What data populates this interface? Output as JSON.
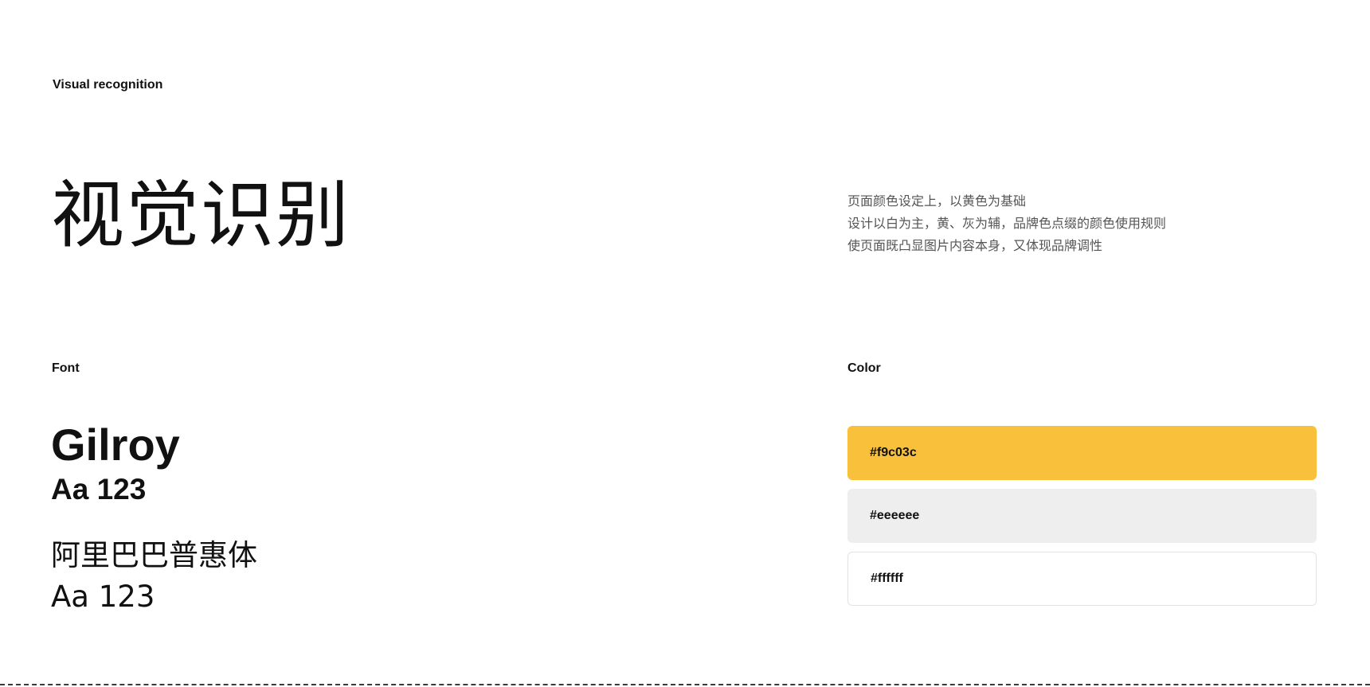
{
  "header": {
    "section_label": "Visual recognition",
    "title": "视觉识别"
  },
  "description": {
    "lines": [
      "页面颜色设定上，以黄色为基础",
      "设计以白为主，黄、灰为辅，品牌色点缀的颜色使用规则",
      "使页面既凸显图片内容本身，又体现品牌调性"
    ]
  },
  "font_section": {
    "label": "Font",
    "latin_font_name": "Gilroy",
    "latin_sample": "Aa 123",
    "cn_font_name": "阿里巴巴普惠体",
    "cn_sample": "Aa 123"
  },
  "color_section": {
    "label": "Color",
    "swatches": [
      {
        "label": "#f9c03c",
        "color": "#f9c03c"
      },
      {
        "label": "#eeeeee",
        "color": "#eeeeee"
      },
      {
        "label": "#ffffff",
        "color": "#ffffff"
      }
    ]
  }
}
